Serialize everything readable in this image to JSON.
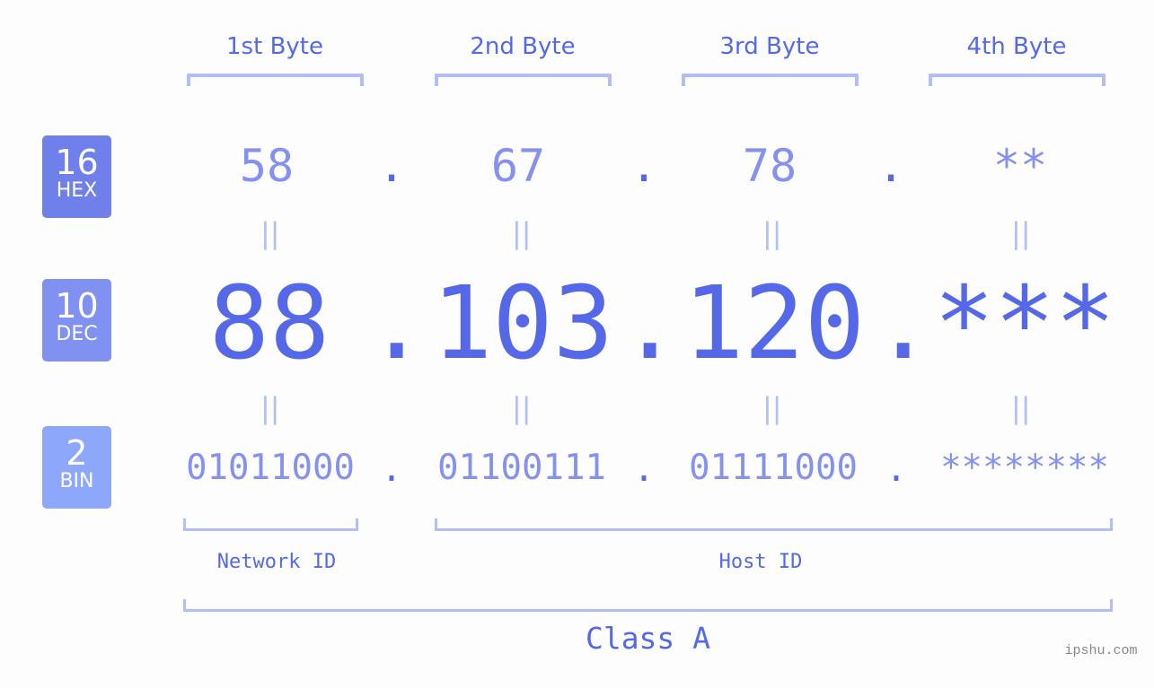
{
  "byte_headers": [
    "1st Byte",
    "2nd Byte",
    "3rd Byte",
    "4th Byte"
  ],
  "badges": {
    "hex": {
      "number": "16",
      "label": "HEX",
      "color": "#7080eb"
    },
    "dec": {
      "number": "10",
      "label": "DEC",
      "color": "#8191f2"
    },
    "bin": {
      "number": "2",
      "label": "BIN",
      "color": "#8da8fb"
    }
  },
  "separator": ".",
  "equals_marker": "||",
  "hex": [
    "58",
    "67",
    "78",
    "**"
  ],
  "dec": [
    "88",
    "103",
    "120",
    "***"
  ],
  "bin": [
    "01011000",
    "01100111",
    "01111000",
    "********"
  ],
  "network_id_label": "Network ID",
  "host_id_label": "Host ID",
  "class_label": "Class A",
  "watermark": "ipshu.com",
  "colors": {
    "primary": "#5468e8",
    "muted_value": "#8591ef",
    "bracket": "#b3bdf6",
    "background": "#fcfdfc"
  }
}
